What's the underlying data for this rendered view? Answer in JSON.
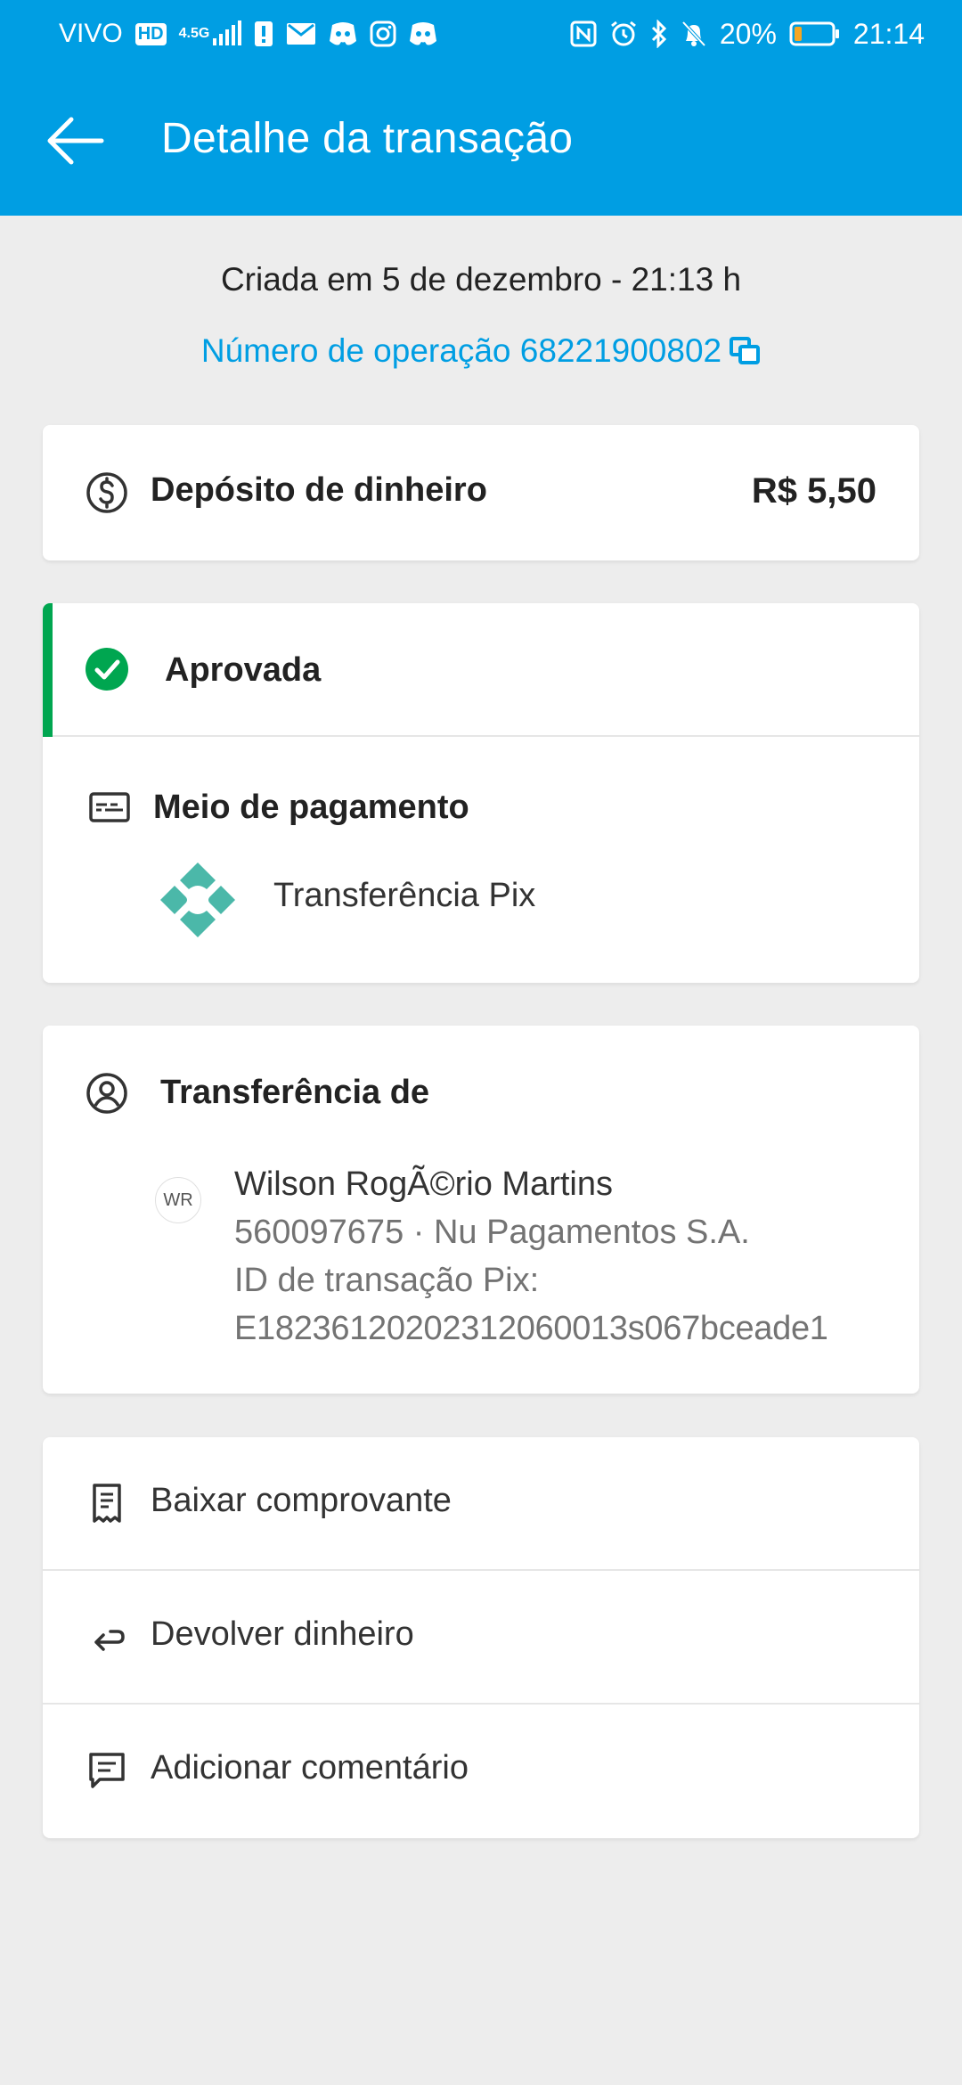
{
  "status_bar": {
    "carrier": "VIVO",
    "hd_badge": "HD",
    "network": "4.5G",
    "battery_percent": "20%",
    "time": "21:14",
    "battery_level": 0.2
  },
  "header": {
    "title": "Detalhe da transação",
    "back_icon": "arrow-left-icon"
  },
  "meta": {
    "created": "Criada em 5 de dezembro - 21:13 h",
    "operation": "Número de operação 68221900802"
  },
  "summary": {
    "label": "Depósito de dinheiro",
    "amount": "R$ 5,50",
    "icon": "dollar-circle-icon"
  },
  "status": {
    "label": "Aprovada",
    "color": "#00a650"
  },
  "payment": {
    "title": "Meio de pagamento",
    "method": "Transferência Pix",
    "pix_color": "#4bb8a9"
  },
  "transfer": {
    "title": "Transferência de",
    "initials": "WR",
    "name": "Wilson RogÃ©rio Martins",
    "account": "560097675 · Nu Pagamentos S.A.",
    "pix_id_label": "ID de transação Pix:",
    "pix_id": "E18236120202312060013s067bceade1"
  },
  "actions": [
    {
      "label": "Baixar comprovante",
      "icon": "receipt-icon"
    },
    {
      "label": "Devolver dinheiro",
      "icon": "return-arrow-icon"
    },
    {
      "label": "Adicionar comentário",
      "icon": "comment-icon"
    }
  ],
  "colors": {
    "brand": "#009ee3",
    "success": "#00a650",
    "background": "#ededed"
  }
}
